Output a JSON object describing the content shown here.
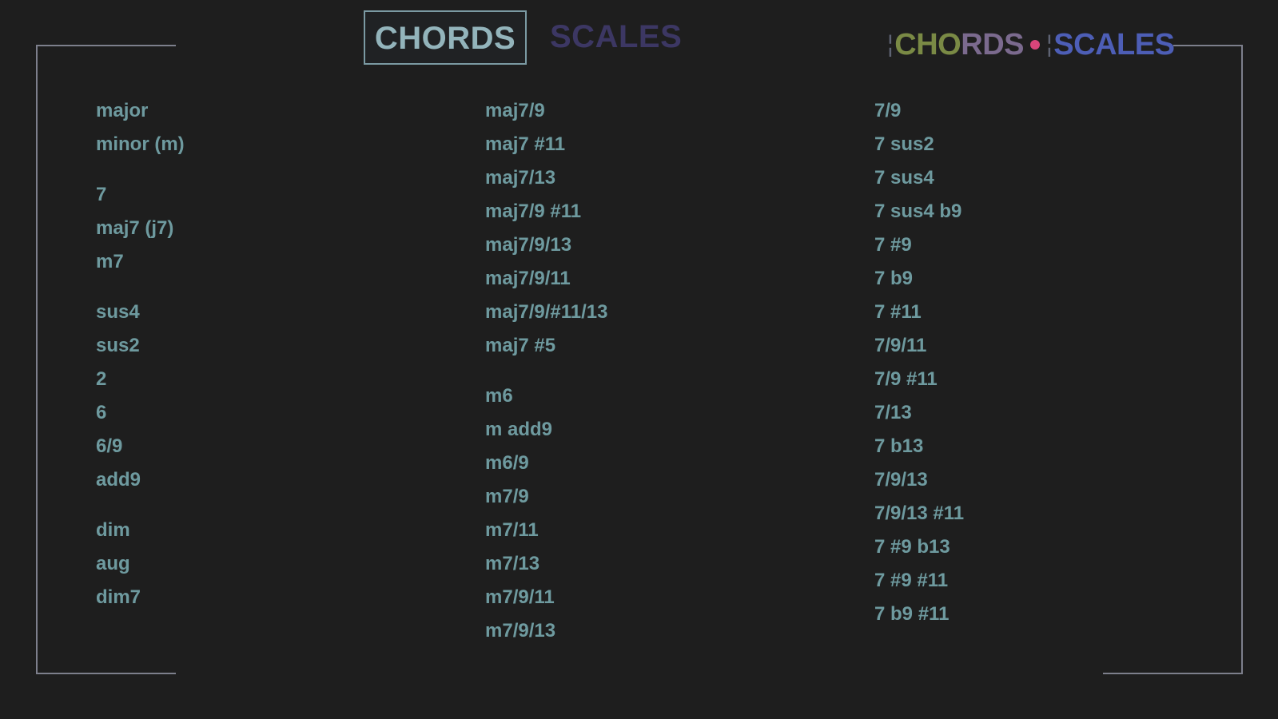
{
  "tabs": {
    "chords_label": "CHORDS",
    "scales_label": "SCALES"
  },
  "logo": {
    "chords_part1": "CHO",
    "chords_part2": "RDS",
    "scales": "SCALES"
  },
  "colors": {
    "background": "#1e1e1e",
    "chord_text": "#6e9a9f",
    "active_tab": "#93b4bb",
    "inactive_tab": "#3c3763",
    "logo_dot": "#d8457a",
    "logo_scales": "#4d5eb6"
  },
  "columns": [
    {
      "groups": [
        [
          "major",
          "minor (m)"
        ],
        [
          "7",
          "maj7 (j7)",
          "m7"
        ],
        [
          "sus4",
          "sus2",
          "2",
          "6",
          "6/9",
          "add9"
        ],
        [
          "dim",
          "aug",
          "dim7"
        ]
      ]
    },
    {
      "groups": [
        [
          "maj7/9",
          "maj7 #11",
          "maj7/13",
          "maj7/9 #11",
          "maj7/9/13",
          "maj7/9/11",
          "maj7/9/#11/13",
          "maj7 #5"
        ],
        [
          "m6",
          "m add9",
          "m6/9",
          "m7/9",
          "m7/11",
          "m7/13",
          "m7/9/11",
          "m7/9/13"
        ]
      ]
    },
    {
      "groups": [
        [
          "7/9",
          "7 sus2",
          "7 sus4",
          "7 sus4 b9",
          "7 #9",
          "7 b9",
          "7 #11",
          "7/9/11",
          "7/9 #11",
          "7/13",
          "7 b13",
          "7/9/13",
          "7/9/13 #11",
          "7 #9 b13",
          "7 #9 #11",
          "7 b9 #11"
        ]
      ]
    }
  ]
}
